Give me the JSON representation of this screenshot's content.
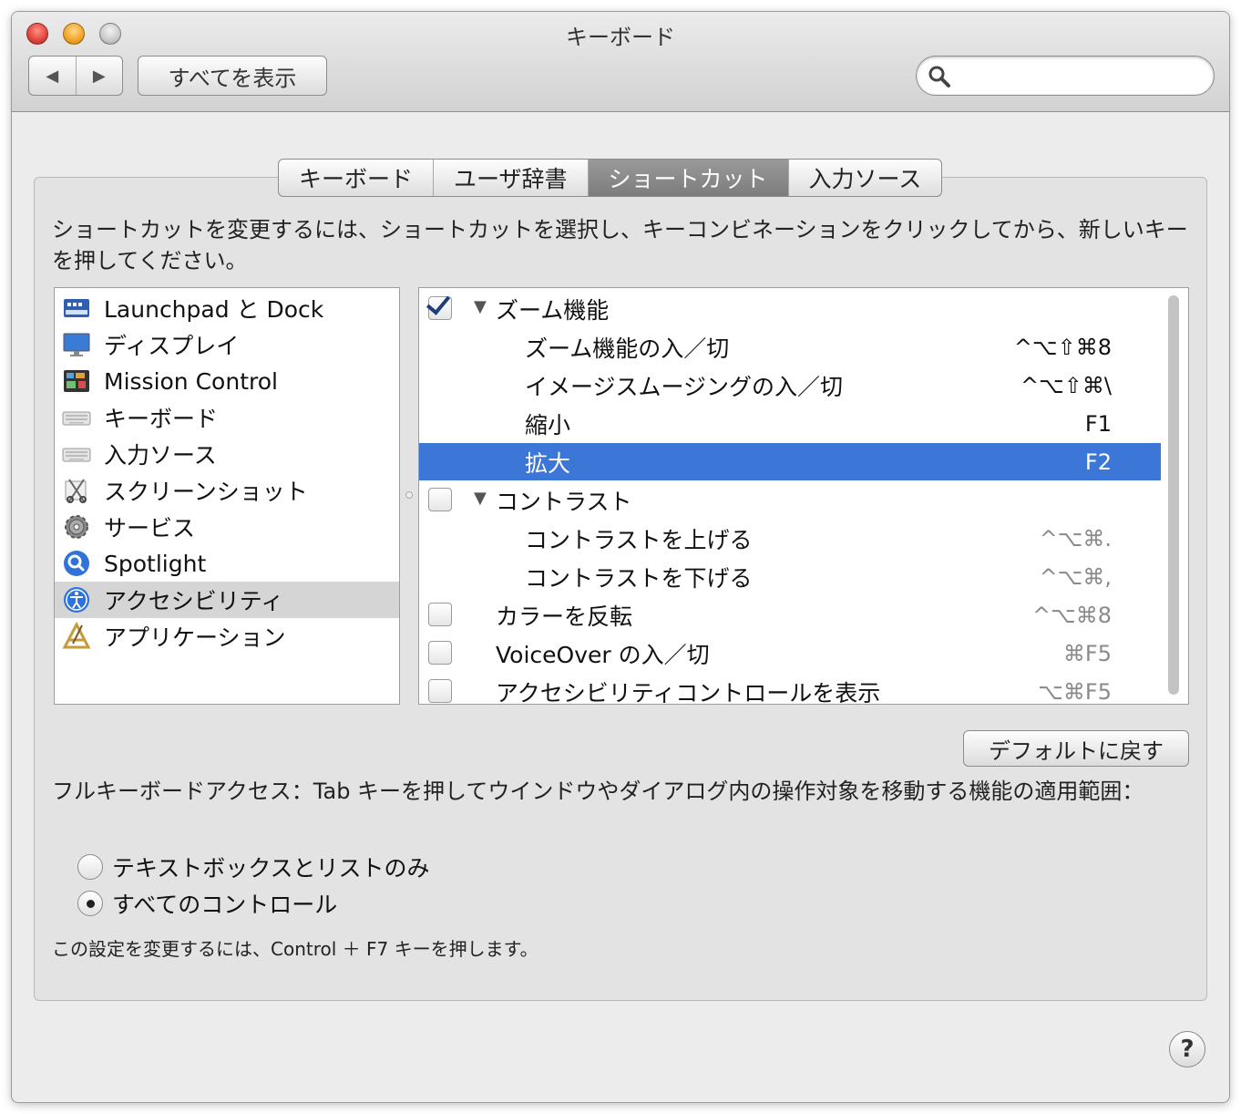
{
  "window": {
    "title": "キーボード"
  },
  "toolbar": {
    "back_label": "◀",
    "forward_label": "▶",
    "show_all_label": "すべてを表示",
    "search_placeholder": ""
  },
  "tabs": [
    {
      "label": "キーボード"
    },
    {
      "label": "ユーザ辞書"
    },
    {
      "label": "ショートカット",
      "active": true
    },
    {
      "label": "入力ソース"
    }
  ],
  "instructions": "ショートカットを変更するには、ショートカットを選択し、キーコンビネーションをクリックしてから、新しいキーを押してください。",
  "categories": [
    {
      "label": "Launchpad と Dock",
      "icon": "launchpad-dock-icon"
    },
    {
      "label": "ディスプレイ",
      "icon": "display-icon"
    },
    {
      "label": "Mission Control",
      "icon": "mission-control-icon"
    },
    {
      "label": "キーボード",
      "icon": "keyboard-icon"
    },
    {
      "label": "入力ソース",
      "icon": "input-source-icon"
    },
    {
      "label": "スクリーンショット",
      "icon": "screenshot-icon"
    },
    {
      "label": "サービス",
      "icon": "services-gear-icon"
    },
    {
      "label": "Spotlight",
      "icon": "spotlight-icon"
    },
    {
      "label": "アクセシビリティ",
      "icon": "accessibility-icon",
      "selected": true
    },
    {
      "label": "アプリケーション",
      "icon": "applications-icon"
    }
  ],
  "shortcuts": [
    {
      "label": "ズーム機能",
      "key": "",
      "type": "group",
      "checked": true
    },
    {
      "label": "ズーム機能の入／切",
      "key": "^⌥⇧⌘8",
      "type": "child"
    },
    {
      "label": "イメージスムージングの入／切",
      "key": "^⌥⇧⌘\\",
      "type": "child"
    },
    {
      "label": "縮小",
      "key": "F1",
      "type": "child"
    },
    {
      "label": "拡大",
      "key": "F2",
      "type": "child",
      "selected": true
    },
    {
      "label": "コントラスト",
      "key": "",
      "type": "group",
      "checked": false
    },
    {
      "label": "コントラストを上げる",
      "key": "^⌥⌘.",
      "type": "child",
      "dim": true
    },
    {
      "label": "コントラストを下げる",
      "key": "^⌥⌘,",
      "type": "child",
      "dim": true
    },
    {
      "label": "カラーを反転",
      "key": "^⌥⌘8",
      "type": "top",
      "checked": false,
      "dim": true
    },
    {
      "label": "VoiceOver の入／切",
      "key": "⌘F5",
      "type": "top",
      "checked": false,
      "dim": true
    },
    {
      "label": "アクセシビリティコントロールを表示",
      "key": "⌥⌘F5",
      "type": "top",
      "checked": false,
      "dim": true
    }
  ],
  "restore_defaults_label": "デフォルトに戻す",
  "full_keyboard_access": {
    "description": "フルキーボードアクセス：Tab キーを押してウインドウやダイアログ内の操作対象を移動する機能の適用範囲：",
    "options": [
      {
        "label": "テキストボックスとリストのみ",
        "selected": false
      },
      {
        "label": "すべてのコントロール",
        "selected": true
      }
    ],
    "note": "この設定を変更するには、Control ＋ F7 キーを押します。"
  },
  "help_label": "?",
  "colors": {
    "selection": "#3c76d6",
    "checkmark": "#1f3d7a"
  }
}
